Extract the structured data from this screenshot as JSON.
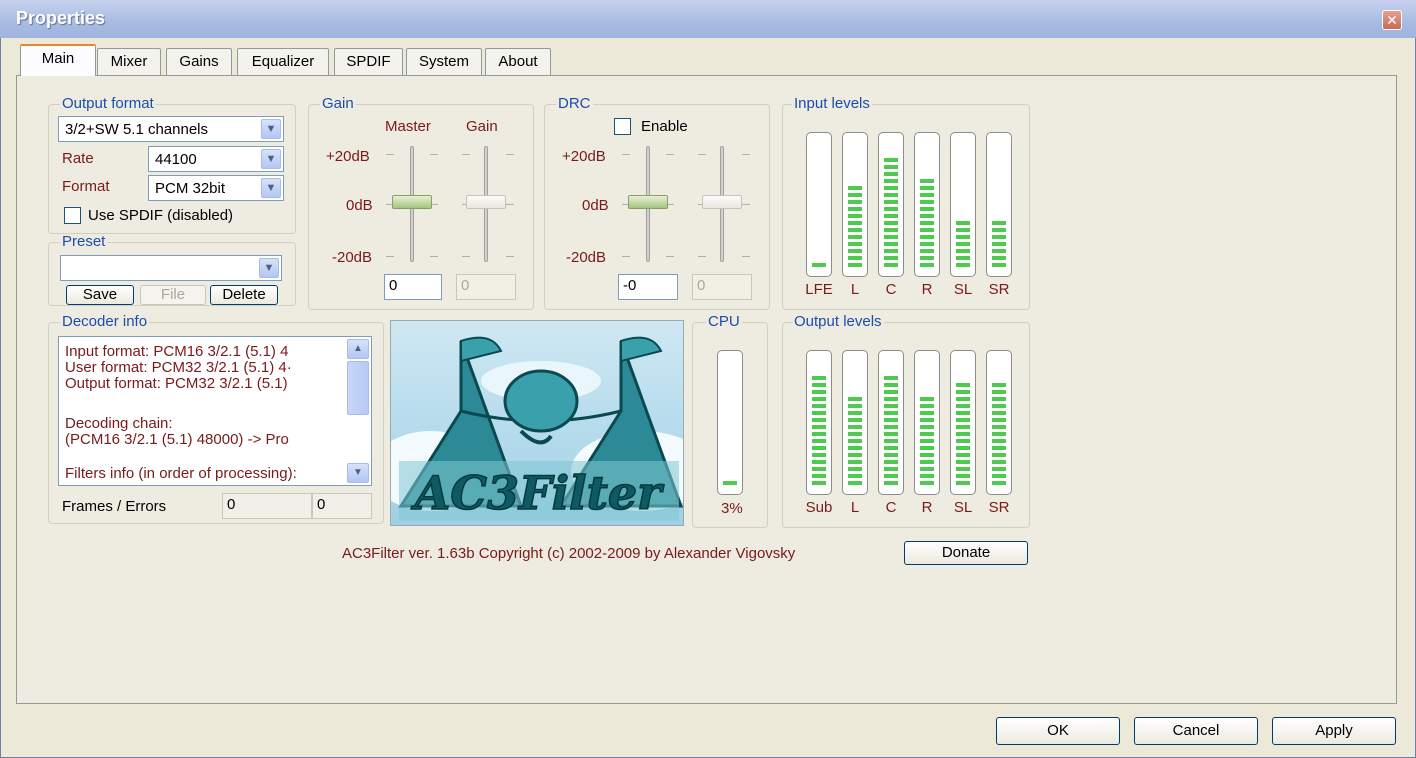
{
  "window": {
    "title": "Properties"
  },
  "tabs": [
    "Main",
    "Mixer",
    "Gains",
    "Equalizer",
    "SPDIF",
    "System",
    "About"
  ],
  "output_format": {
    "label": "Output format",
    "channels_value": "3/2+SW 5.1 channels",
    "rate_label": "Rate",
    "rate_value": "44100",
    "format_label": "Format",
    "format_value": "PCM 32bit",
    "spdif_label": "Use SPDIF (disabled)"
  },
  "preset": {
    "label": "Preset",
    "value": "",
    "save": "Save",
    "file": "File",
    "delete": "Delete"
  },
  "gain": {
    "label": "Gain",
    "master_label": "Master",
    "gain_label": "Gain",
    "plus20": "+20dB",
    "zero": "0dB",
    "minus20": "-20dB",
    "master_value": "0",
    "gain_value": "0"
  },
  "drc": {
    "label": "DRC",
    "enable_label": "Enable",
    "plus20": "+20dB",
    "zero": "0dB",
    "minus20": "-20dB",
    "drc_value": "-0",
    "gain_value": "0"
  },
  "input_levels": {
    "label": "Input levels",
    "channels": [
      "LFE",
      "L",
      "C",
      "R",
      "SL",
      "SR"
    ],
    "levels": [
      0.05,
      0.62,
      0.85,
      0.67,
      0.38,
      0.38
    ]
  },
  "output_levels": {
    "label": "Output levels",
    "channels": [
      "Sub",
      "L",
      "C",
      "R",
      "SL",
      "SR"
    ],
    "levels": [
      0.86,
      0.71,
      0.86,
      0.71,
      0.79,
      0.79
    ]
  },
  "decoder_info": {
    "label": "Decoder info",
    "lines": [
      "Input format: PCM16 3/2.1 (5.1) 4",
      "User format: PCM32 3/2.1 (5.1) 4·",
      "Output format: PCM32 3/2.1 (5.1)",
      "",
      "Decoding chain:",
      "(PCM16 3/2.1 (5.1) 48000) -> Pro",
      "",
      "Filters info (in order of processing):"
    ],
    "frames_label": "Frames / Errors",
    "frames_value": "0",
    "errors_value": "0"
  },
  "logo": {
    "text": "AC3Filter"
  },
  "cpu": {
    "label": "CPU",
    "value": "3%",
    "level": 0.05
  },
  "copyright": "AC3Filter ver. 1.63b Copyright (c) 2002-2009 by Alexander Vigovsky",
  "donate": "Donate",
  "footer": {
    "ok": "OK",
    "cancel": "Cancel",
    "apply": "Apply"
  },
  "colors": {
    "titlebar": "#a9bbe2",
    "group_label": "#1c4baf",
    "meter_green": "#4ecb4e",
    "maroon": "#7a1a1a",
    "tab_accent": "#e68b2c"
  }
}
